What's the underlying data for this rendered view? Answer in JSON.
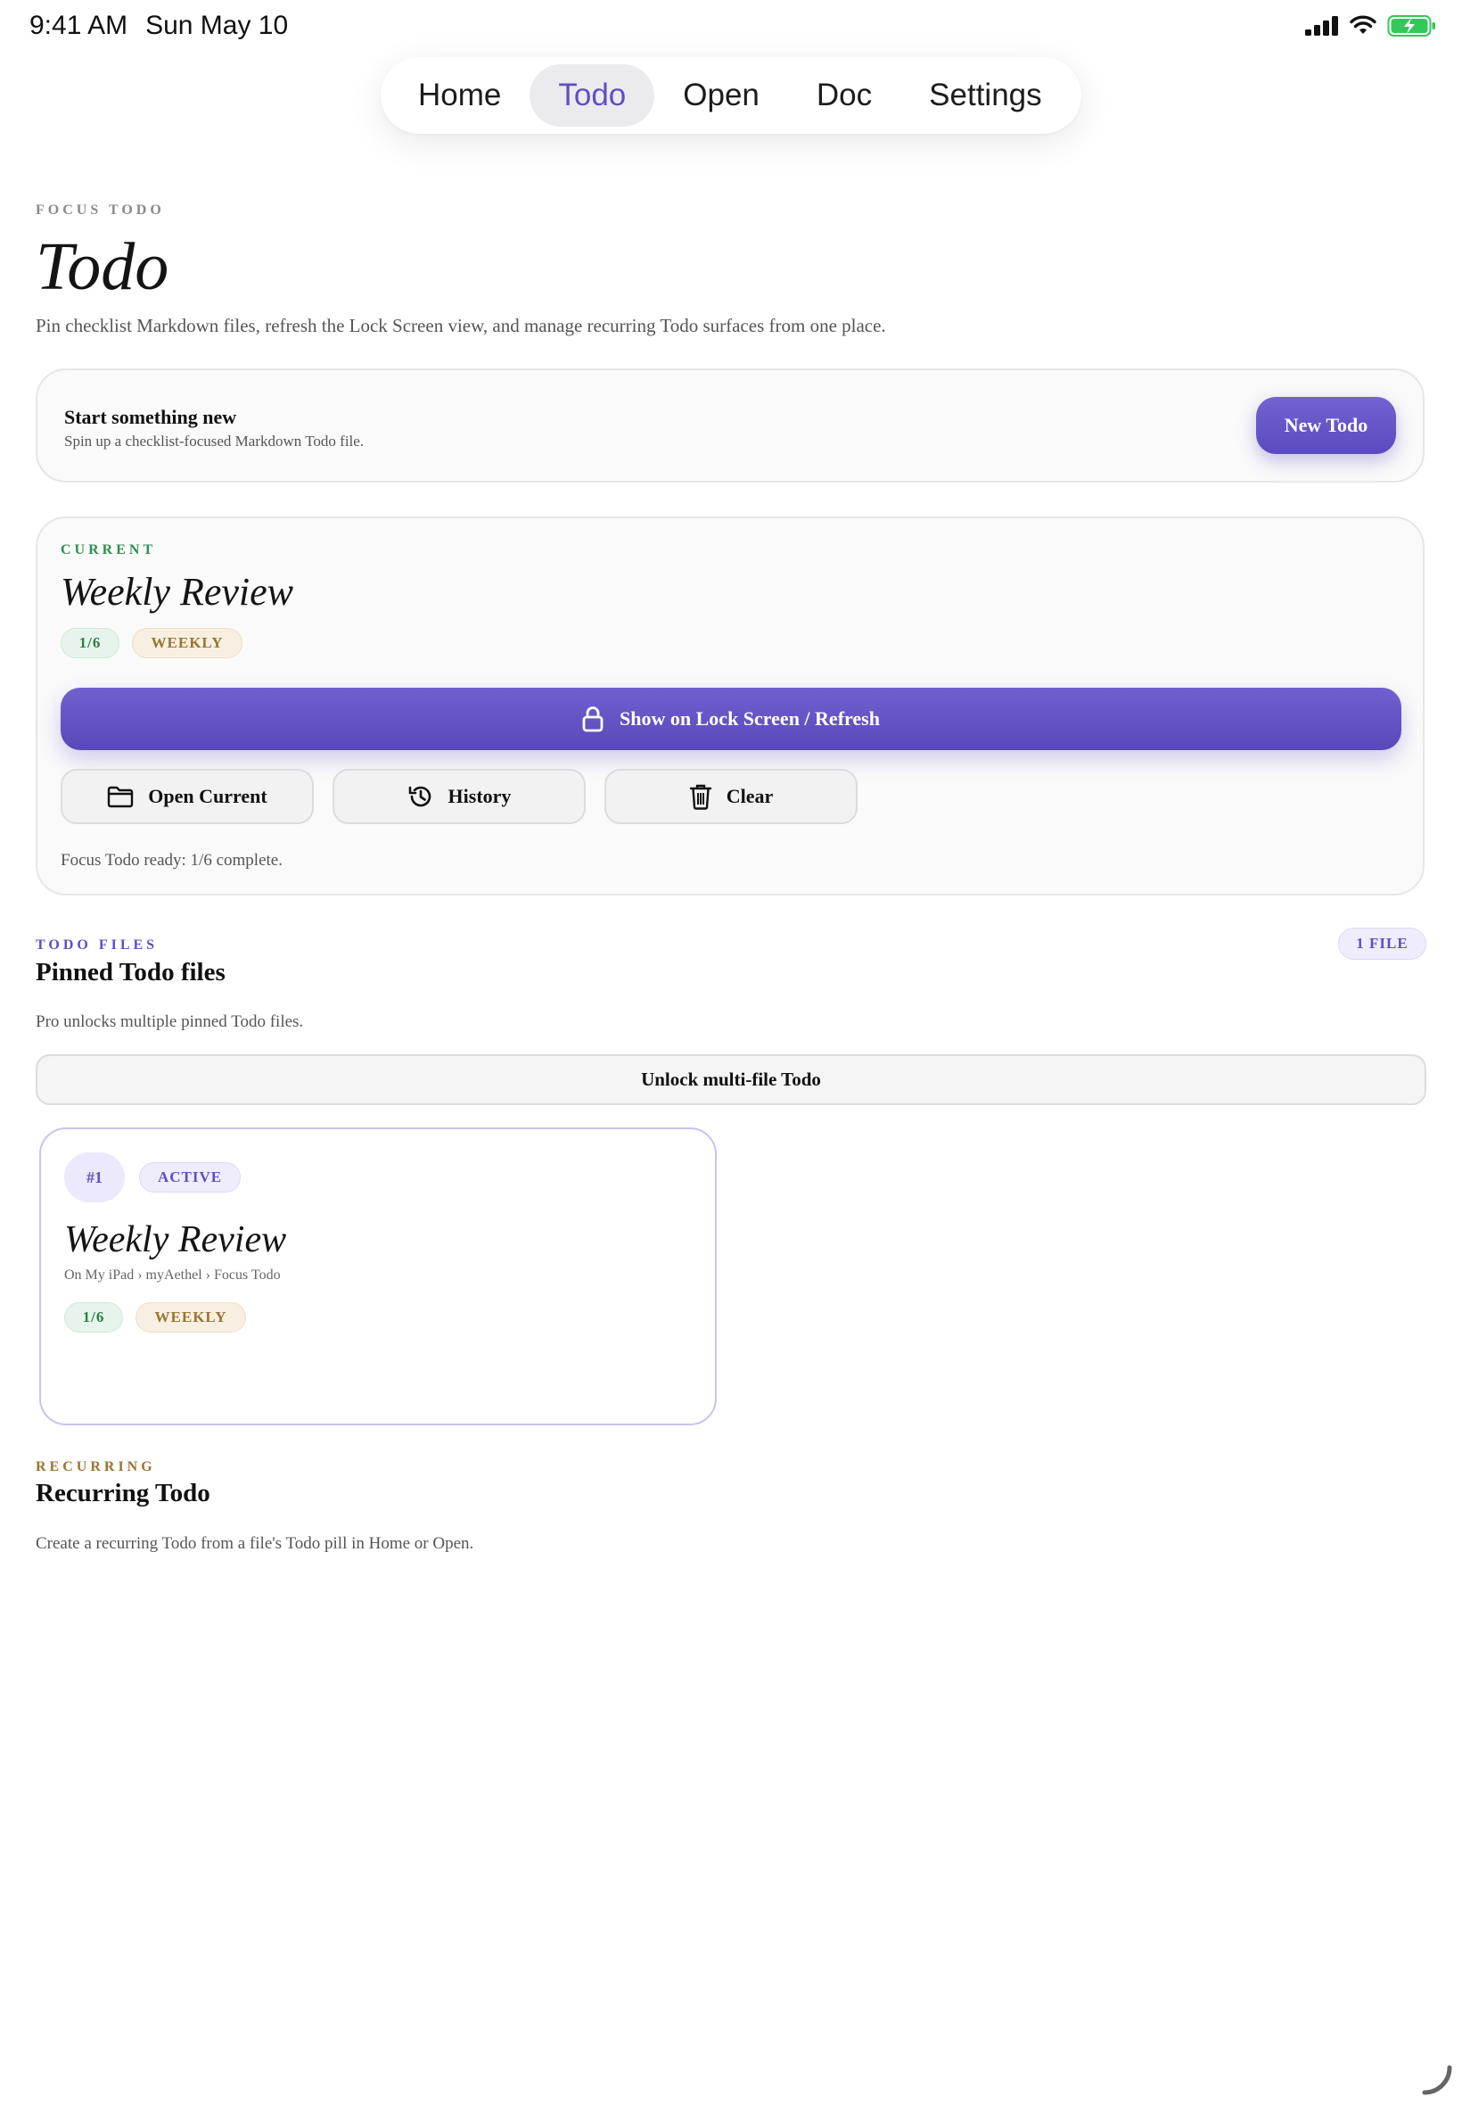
{
  "status_bar": {
    "time": "9:41 AM",
    "date": "Sun May 10",
    "icons": [
      "cellular-signal-icon",
      "wifi-icon",
      "battery-charging-icon"
    ]
  },
  "nav": {
    "tabs": [
      {
        "label": "Home",
        "active": false
      },
      {
        "label": "Todo",
        "active": true
      },
      {
        "label": "Open",
        "active": false
      },
      {
        "label": "Doc",
        "active": false
      },
      {
        "label": "Settings",
        "active": false
      }
    ]
  },
  "header": {
    "eyebrow": "FOCUS TODO",
    "title": "Todo",
    "subtitle": "Pin checklist Markdown files, refresh the Lock Screen view, and manage recurring Todo surfaces from one place."
  },
  "new_todo": {
    "title": "Start something new",
    "description": "Spin up a checklist-focused Markdown Todo file.",
    "button_label": "New Todo"
  },
  "current": {
    "eyebrow": "CURRENT",
    "name": "Weekly Review",
    "progress_pill": "1/6",
    "frequency_pill": "WEEKLY",
    "lock_screen_button": "Show on Lock Screen / Refresh",
    "actions": {
      "open_current": "Open Current",
      "history": "History",
      "clear": "Clear"
    },
    "status": "Focus Todo ready: 1/6 complete."
  },
  "todo_files": {
    "eyebrow": "TODO FILES",
    "count_badge": "1 FILE",
    "title": "Pinned Todo files",
    "note": "Pro unlocks multiple pinned Todo files.",
    "unlock_button": "Unlock multi-file Todo",
    "files": [
      {
        "index": "#1",
        "state": "ACTIVE",
        "name": "Weekly Review",
        "path": "On My iPad › myAethel › Focus Todo",
        "progress": "1/6",
        "frequency": "WEEKLY"
      }
    ]
  },
  "recurring": {
    "eyebrow": "RECURRING",
    "title": "Recurring Todo",
    "note": "Create a recurring Todo from a file's Todo pill in Home or Open."
  },
  "colors": {
    "accent": "#5e4fc4",
    "current_green": "#2f8f53",
    "recurring_gold": "#9a7430"
  }
}
